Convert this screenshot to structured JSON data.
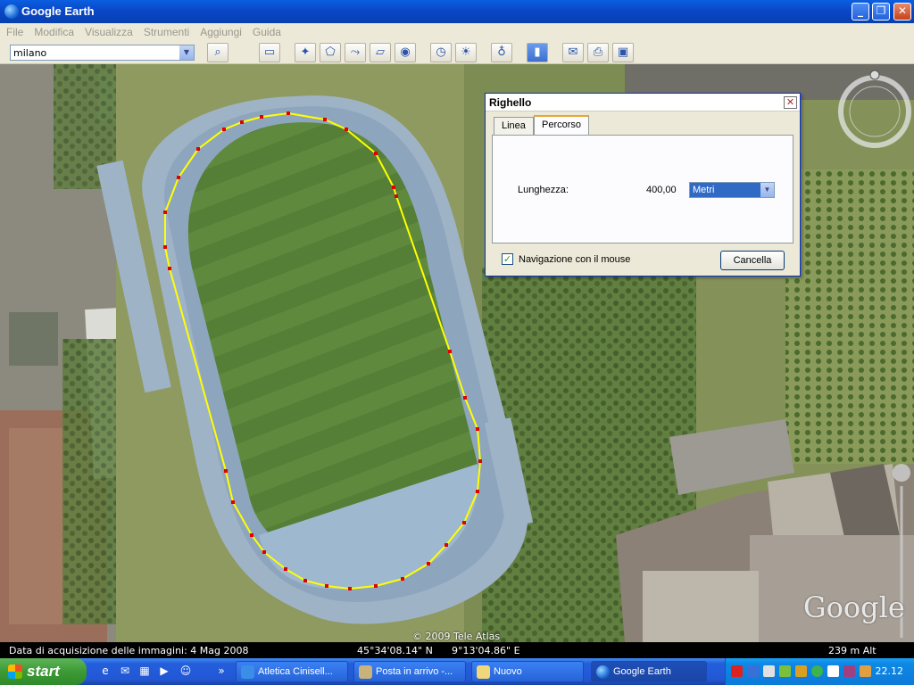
{
  "window": {
    "title": "Google Earth"
  },
  "menu": [
    "File",
    "Modifica",
    "Visualizza",
    "Strumenti",
    "Aggiungi",
    "Guida"
  ],
  "toolbar": {
    "search_value": "milano"
  },
  "ruler": {
    "title": "Righello",
    "tabs": [
      "Linea",
      "Percorso"
    ],
    "active_tab": "Percorso",
    "length_label": "Lunghezza:",
    "length_value": "400,00",
    "unit": "Metri",
    "mouse_nav_label": "Navigazione con il mouse",
    "mouse_nav_checked": true,
    "cancel_label": "Cancella"
  },
  "map": {
    "copyright": "© 2009 Tele Atlas",
    "logo": "Google",
    "path_color": "#ffff00",
    "point_color": "#e00000"
  },
  "status": {
    "imagery_date": "Data di acquisizione delle immagini:  4 Mag 2008",
    "latitude": "45°34'08.14\" N",
    "longitude": "9°13'04.86\" E",
    "altitude": "239 m Alt"
  },
  "taskbar": {
    "start_label": "start",
    "tasks": [
      {
        "label": "Atletica Cinisell...",
        "icon": "internet-explorer-icon",
        "active": false
      },
      {
        "label": "Posta in arrivo -...",
        "icon": "mail-icon",
        "active": false
      },
      {
        "label": "Nuovo",
        "icon": "folder-icon",
        "active": false
      },
      {
        "label": "Google Earth",
        "icon": "google-earth-icon",
        "active": true
      }
    ],
    "clock": "22.12"
  }
}
